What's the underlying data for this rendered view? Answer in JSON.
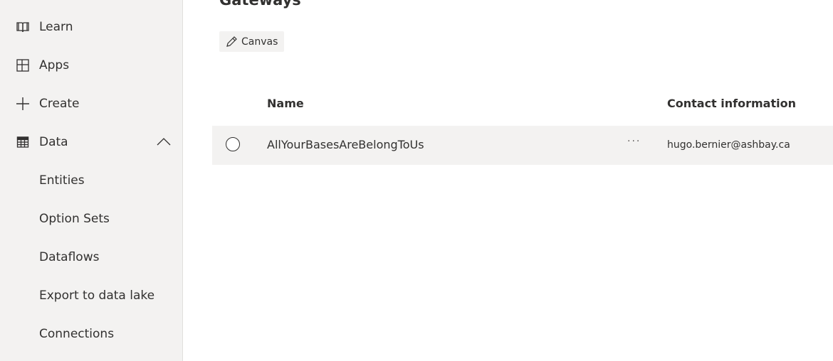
{
  "sidebar": {
    "items": [
      {
        "label": "Learn",
        "icon": "book-icon"
      },
      {
        "label": "Apps",
        "icon": "apps-icon"
      },
      {
        "label": "Create",
        "icon": "plus-icon"
      },
      {
        "label": "Data",
        "icon": "table-icon",
        "expanded": true
      },
      {
        "label": "Entities"
      },
      {
        "label": "Option Sets"
      },
      {
        "label": "Dataflows"
      },
      {
        "label": "Export to data lake"
      },
      {
        "label": "Connections"
      }
    ]
  },
  "page": {
    "title": "Gateways",
    "chip_label": "Canvas"
  },
  "table": {
    "columns": [
      "Name",
      "Contact information"
    ],
    "rows": [
      {
        "name": "AllYourBasesAreBelongToUs",
        "more": "···",
        "contact": "hugo.bernier@ashbay.ca"
      }
    ]
  }
}
